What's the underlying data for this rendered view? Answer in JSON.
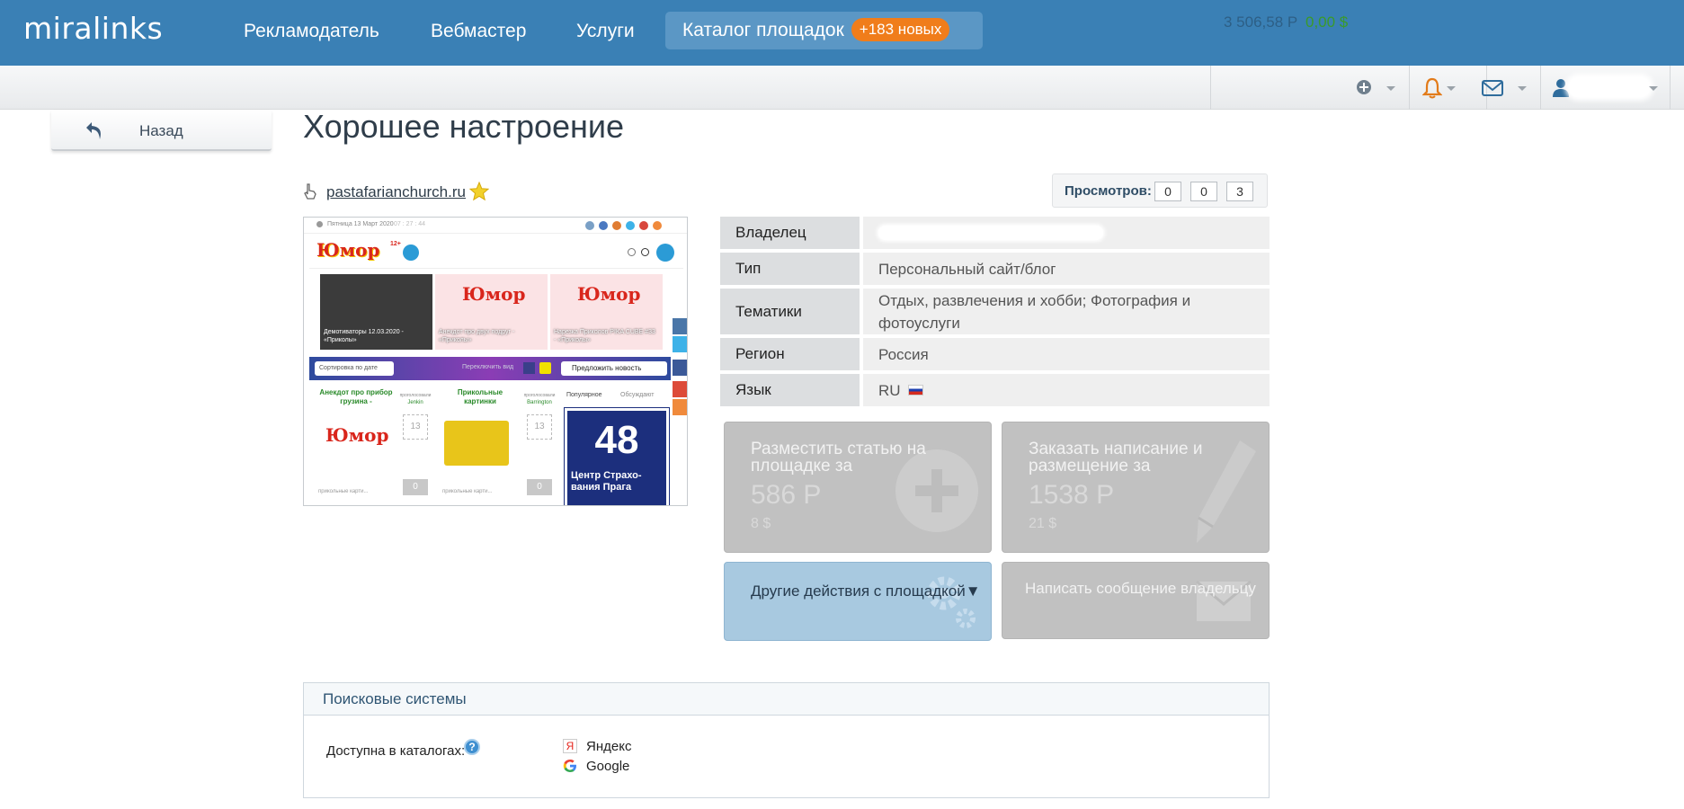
{
  "header": {
    "logo": "miralinks",
    "nav": [
      "Рекламодатель",
      "Вебмастер",
      "Услуги"
    ],
    "catalog": {
      "label": "Каталог площадок",
      "badge": "+183 новых"
    }
  },
  "subbar": {
    "balance_rub": "3 506,58 Р",
    "balance_usd": "0,00 $"
  },
  "back_button": {
    "label": "Назад"
  },
  "page": {
    "title": "Хорошее настроение",
    "site_url": "pastafarianchurch.ru",
    "views_label": "Просмотров:",
    "views": [
      "0",
      "0",
      "3"
    ]
  },
  "thumbnail": {
    "date": "Пятница 13 Март 2020",
    "time": "07 : 27 : 44",
    "brand": "Юмор",
    "age": "12+",
    "cards": [
      "Демотиваторы 12.03.2020 - «Приколы»",
      "Анекдот про двух подруг - «Приколы»",
      "Нарезка Приколов PIKA CUBE #33 - «Приколы»"
    ],
    "sort": "Сортировка по дате",
    "switch_view": "Переключить вид",
    "suggest": "Предложить новость",
    "post1": "Анекдот про прибор грузина -",
    "post2": "Прикольные картинки",
    "tab_popular": "Популярное",
    "tab_discussed": "Обсуждают",
    "vote_label": "проголосовали",
    "votes": "13",
    "score": "0",
    "voter1": "Jenkin",
    "voter2": "Barrington",
    "tag": "прикольные карти...",
    "sign_number": "48",
    "sign_text": "Центр Страхо-вания Прага"
  },
  "info": [
    {
      "key": "Владелец",
      "value": ""
    },
    {
      "key": "Тип",
      "value": "Персональный сайт/блог"
    },
    {
      "key": "Тематики",
      "value": "Отдых, развлечения и хобби; Фотография и фотоуслуги"
    },
    {
      "key": "Регион",
      "value": "Россия"
    },
    {
      "key": "Язык",
      "value": "RU"
    }
  ],
  "actions": {
    "place": {
      "title": "Разместить статью на площадке за",
      "price": "586 Р",
      "usd": "8 $"
    },
    "order": {
      "title": "Заказать написание и размещение за",
      "price": "1538 Р",
      "usd": "21 $"
    },
    "other": {
      "title": "Другие действия с площадкой▼"
    },
    "message": {
      "title": "Написать сообщение владельцу"
    }
  },
  "search_systems": {
    "title": "Поисковые системы",
    "available_label": "Доступна в каталогах:",
    "help": "?",
    "engines": [
      {
        "name": "Яндекс",
        "icon": "yandex-icon",
        "icon_text": "Я"
      },
      {
        "name": "Google",
        "icon": "google-icon"
      }
    ]
  },
  "colors": {
    "header": "#3a80b5",
    "badge": "#f07d1b",
    "card_gray": "#c1c1c1",
    "card_blue": "#a8c9e0"
  }
}
